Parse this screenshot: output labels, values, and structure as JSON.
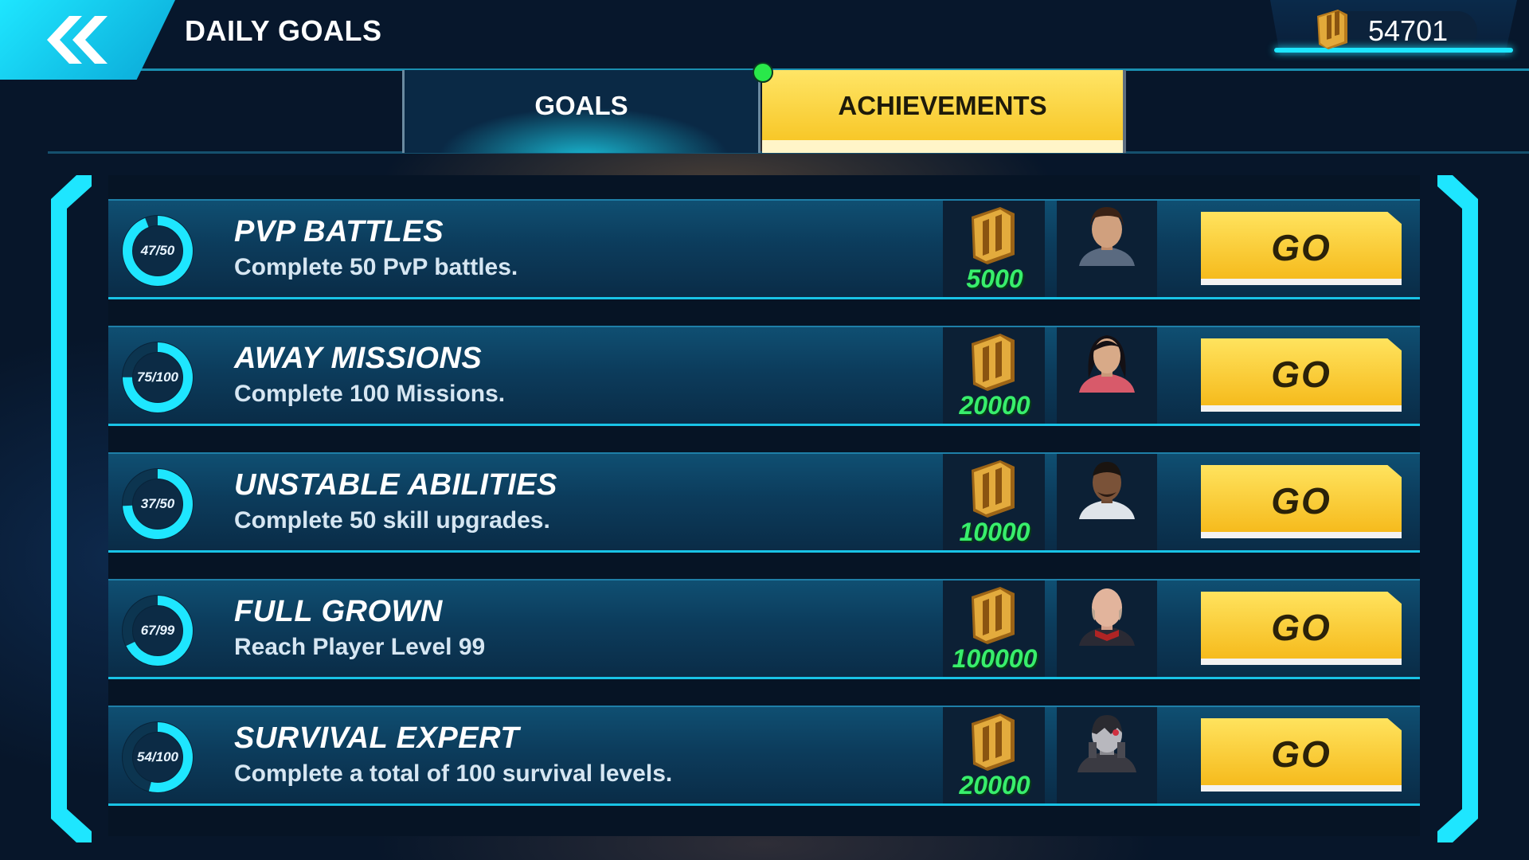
{
  "header": {
    "title": "DAILY GOALS",
    "currency": "54701"
  },
  "tabs": [
    {
      "label": "GOALS",
      "active": false
    },
    {
      "label": "ACHIEVEMENTS",
      "active": true
    }
  ],
  "colors": {
    "accent": "#1ee6ff",
    "gold": "#f6c21d",
    "reward_green": "#38ee6c"
  },
  "goals": [
    {
      "title": "PVP BATTLES",
      "description": "Complete 50 PvP battles.",
      "progress_label": "47/50",
      "progress": 0.94,
      "reward": "5000",
      "portrait": "vulcan-officer-portrait",
      "button": "GO"
    },
    {
      "title": "AWAY MISSIONS",
      "description": "Complete 100 Missions.",
      "progress_label": "75/100",
      "progress": 0.75,
      "reward": "20000",
      "portrait": "counselor-portrait",
      "button": "GO"
    },
    {
      "title": "UNSTABLE ABILITIES",
      "description": "Complete 50 skill upgrades.",
      "progress_label": "37/50",
      "progress": 0.74,
      "reward": "10000",
      "portrait": "officer-portrait",
      "button": "GO"
    },
    {
      "title": "FULL GROWN",
      "description": "Reach Player Level 99",
      "progress_label": "67/99",
      "progress": 0.677,
      "reward": "100000",
      "portrait": "captain-portrait",
      "button": "GO"
    },
    {
      "title": "SURVIVAL EXPERT",
      "description": "Complete a total of 100 survival levels.",
      "progress_label": "54/100",
      "progress": 0.54,
      "reward": "20000",
      "portrait": "borg-portrait",
      "button": "GO"
    }
  ]
}
